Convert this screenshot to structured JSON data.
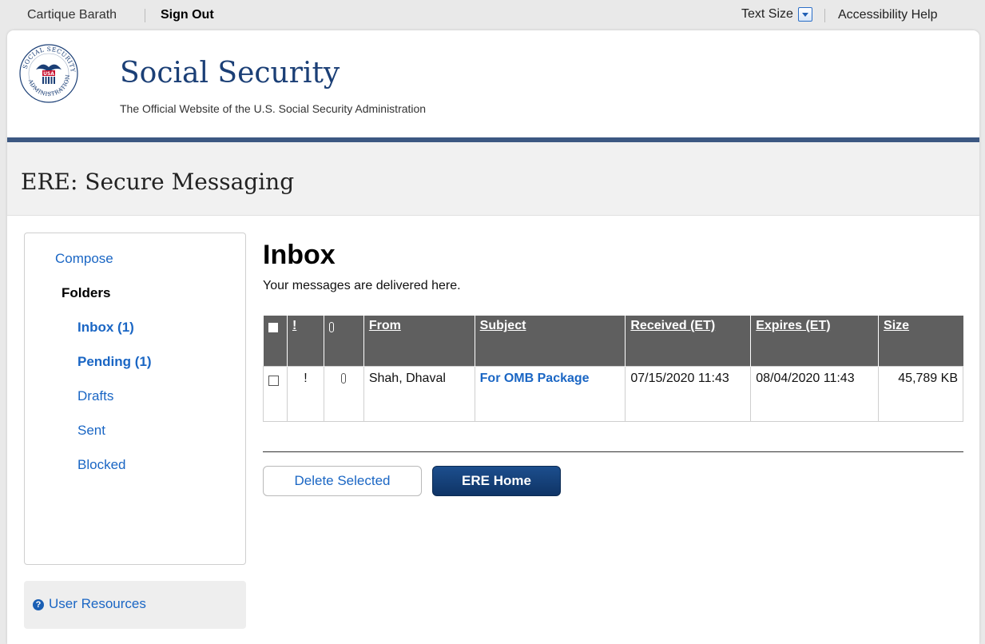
{
  "topbar": {
    "user_name": "Cartique Barath",
    "sign_out": "Sign Out",
    "text_size": "Text Size",
    "accessibility_help": "Accessibility Help"
  },
  "header": {
    "brand": "Social Security",
    "tagline": "The Official Website of the U.S. Social Security Administration",
    "seal_text": {
      "top": "SOCIAL SECURITY",
      "bottom": "ADMINISTRATION",
      "center": "USA"
    }
  },
  "page_title": "ERE: Secure Messaging",
  "sidebar": {
    "compose": "Compose",
    "folders_heading": "Folders",
    "folders": [
      {
        "label": "Inbox (1)",
        "bold": true
      },
      {
        "label": "Pending (1)",
        "bold": true
      },
      {
        "label": "Drafts",
        "bold": false
      },
      {
        "label": "Sent",
        "bold": false
      },
      {
        "label": "Blocked",
        "bold": false
      }
    ],
    "user_resources": "User Resources"
  },
  "main": {
    "title": "Inbox",
    "subtitle": "Your messages are delivered here.",
    "table": {
      "headers": {
        "priority": "!",
        "from": "From",
        "subject": "Subject",
        "received": "Received (ET)",
        "expires": "Expires (ET)",
        "size": "Size"
      },
      "rows": [
        {
          "priority": "!",
          "from": "Shah, Dhaval",
          "subject": "For OMB Package",
          "received": "07/15/2020 11:43",
          "expires": "08/04/2020 11:43",
          "size": "45,789 KB"
        }
      ]
    },
    "buttons": {
      "delete_selected": "Delete Selected",
      "ere_home": "ERE Home"
    }
  },
  "colors": {
    "brand_navy": "#1b3f76",
    "link_blue": "#1a66c4",
    "header_rule": "#3c5882",
    "table_header_bg": "#5f5f5f",
    "button_primary": "#123f78"
  },
  "icons": [
    "ssa-seal-logo",
    "text-size-dropdown-icon",
    "attachment-clip-icon",
    "help-question-icon",
    "checkbox"
  ]
}
